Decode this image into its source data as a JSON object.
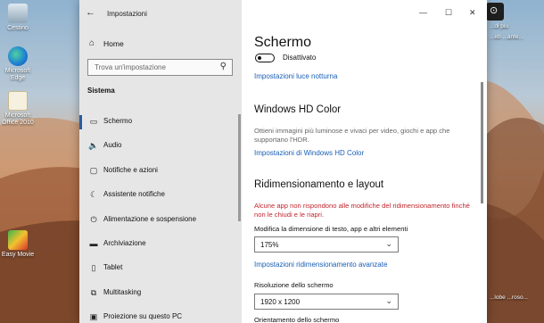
{
  "desktop": {
    "icons": [
      {
        "label": "Cestino",
        "name": "recycle-bin"
      },
      {
        "label": "Microsoft Edge",
        "name": "edge"
      },
      {
        "label": "Microsoft Office 2010",
        "name": "office"
      },
      {
        "label": "Easy Movie",
        "name": "easy-movie"
      }
    ],
    "right_labels": [
      "...di piu",
      "...eb ...ante..."
    ],
    "right_bottom": [
      "...lobe ...roso..."
    ]
  },
  "window": {
    "title": "Impostazioni",
    "controls": {
      "minimize": "—",
      "maximize": "☐",
      "close": "✕"
    }
  },
  "sidebar": {
    "home_label": "Home",
    "search_placeholder": "Trova un'impostazione",
    "section_title": "Sistema",
    "items": [
      {
        "label": "Schermo",
        "icon": "monitor-icon",
        "glyph": "▭",
        "active": true
      },
      {
        "label": "Audio",
        "icon": "speaker-icon",
        "glyph": "🔈"
      },
      {
        "label": "Notifiche e azioni",
        "icon": "notification-icon",
        "glyph": "▢"
      },
      {
        "label": "Assistente notifiche",
        "icon": "moon-icon",
        "glyph": "☾"
      },
      {
        "label": "Alimentazione e sospensione",
        "icon": "power-icon",
        "glyph": "⏻"
      },
      {
        "label": "Archiviazione",
        "icon": "storage-icon",
        "glyph": "▬"
      },
      {
        "label": "Tablet",
        "icon": "tablet-icon",
        "glyph": "▯"
      },
      {
        "label": "Multitasking",
        "icon": "multitasking-icon",
        "glyph": "⧉"
      },
      {
        "label": "Proiezione su questo PC",
        "icon": "projection-icon",
        "glyph": "▣"
      }
    ]
  },
  "main": {
    "title": "Schermo",
    "night_light_state": "Disattivato",
    "night_light_link": "Impostazioni luce notturna",
    "hdr_heading": "Windows HD Color",
    "hdr_desc": "Ottieni immagini più luminose e vivaci per video, giochi e app che supportano l'HDR.",
    "hdr_link": "Impostazioni di Windows HD Color",
    "scale_heading": "Ridimensionamento e layout",
    "scale_warning": "Alcune app non rispondono alle modifiche del ridimensionamento finché non le chiudi e le riapri.",
    "scale_label": "Modifica la dimensione di testo, app e altri elementi",
    "scale_value": "175%",
    "scale_link": "Impostazioni ridimensionamento avanzate",
    "resolution_label": "Risoluzione dello schermo",
    "resolution_value": "1920 x 1200",
    "orientation_label": "Orientamento dello schermo"
  },
  "colors": {
    "accent": "#1a5fb4",
    "warning": "#c0262d",
    "sidebar_bg": "#e6e6e6"
  }
}
